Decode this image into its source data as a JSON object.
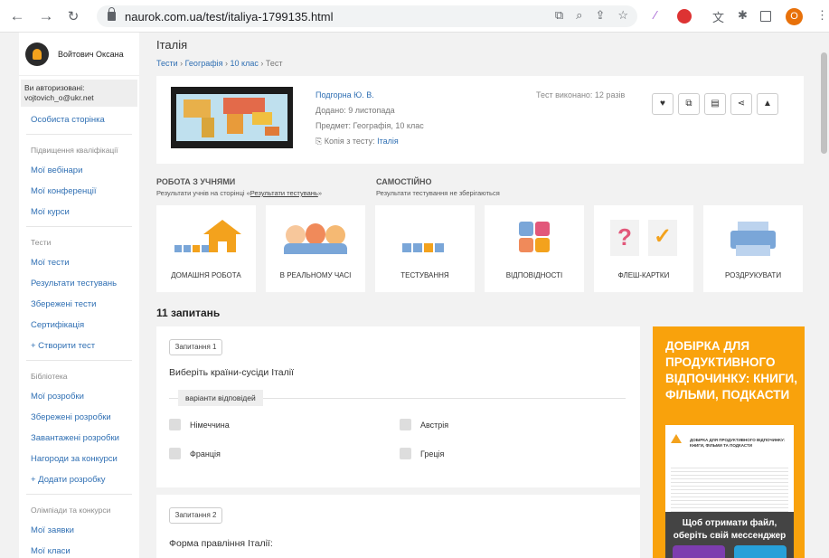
{
  "browser": {
    "url": "naurok.com.ua/test/italiya-1799135.html",
    "profile_letter": "O"
  },
  "sidebar": {
    "user_name": "Войтович Оксана",
    "auth_label": "Ви авторизовані:",
    "auth_email": "vojtovich_o@ukr.net",
    "profile_link": "Особиста сторінка",
    "sections": [
      {
        "head": "Підвищення кваліфікації",
        "items": [
          "Мої вебінари",
          "Мої конференції",
          "Мої курси"
        ]
      },
      {
        "head": "Тести",
        "items": [
          "Мої тести",
          "Результати тестувань",
          "Збережені тести",
          "Сертифікація"
        ],
        "action": "+ Створити тест"
      },
      {
        "head": "Бібліотека",
        "items": [
          "Мої розробки",
          "Збережені розробки",
          "Завантажені розробки",
          "Нагороди за конкурси"
        ],
        "action": "+ Додати розробку"
      },
      {
        "head": "Олімпіади та конкурси",
        "items": [
          "Мої заявки",
          "Мої класи"
        ]
      }
    ]
  },
  "page": {
    "title": "Італія",
    "breadcrumb": [
      "Тести",
      "Географія",
      "10 клас",
      "Тест"
    ],
    "author": "Подгорна Ю. В.",
    "added": "Додано: 9 листопада",
    "subject": "Предмет: Географія, 10 клас",
    "copy_prefix": "Копія з тесту:",
    "copy_link": "Італія",
    "done": "Тест виконано: 12 разів",
    "section_left_title": "РОБОТА З УЧНЯМИ",
    "section_left_sub_prefix": "Результати учнів на сторінці «",
    "section_left_sub_link": "Результати тестувань",
    "section_left_sub_suffix": "»",
    "section_right_title": "САМОСТІЙНО",
    "section_right_sub": "Результати тестування не зберігаються",
    "tiles": [
      "ДОМАШНЯ РОБОТА",
      "В РЕАЛЬНОМУ ЧАСІ",
      "ТЕСТУВАННЯ",
      "ВІДПОВІДНОСТІ",
      "ФЛЕШ-КАРТКИ",
      "РОЗДРУКУВАТИ"
    ],
    "question_count": "11 запитань"
  },
  "questions": [
    {
      "badge": "Запитання 1",
      "text": "Виберіть країни-сусіди Італії",
      "variants_label": "варіанти відповідей",
      "options": [
        "Німеччина",
        "Австрія",
        "Франція",
        "Греція"
      ]
    },
    {
      "badge": "Запитання 2",
      "text": "Форма правління Італії:"
    }
  ],
  "promo": {
    "title": "ДОБІРКА ДЛЯ ПРОДУКТИВНОГО ВІДПОЧИНКУ: КНИГИ, ФІЛЬМИ, ПОДКАСТИ",
    "doc_heading": "ДОБІРКА ДЛЯ ПРОДУКТИВНОГО ВІДПОЧИНКУ: КНИГИ, ФІЛЬМИ ТА ПОДКАСТИ",
    "cta": "Щоб отримати файл, оберіть свій мессенджер"
  },
  "colors": {
    "link": "#2f6fb3",
    "promo": "#f9a20c",
    "tile_orange": "#f3a21d",
    "tile_blue": "#7aa6d8"
  }
}
